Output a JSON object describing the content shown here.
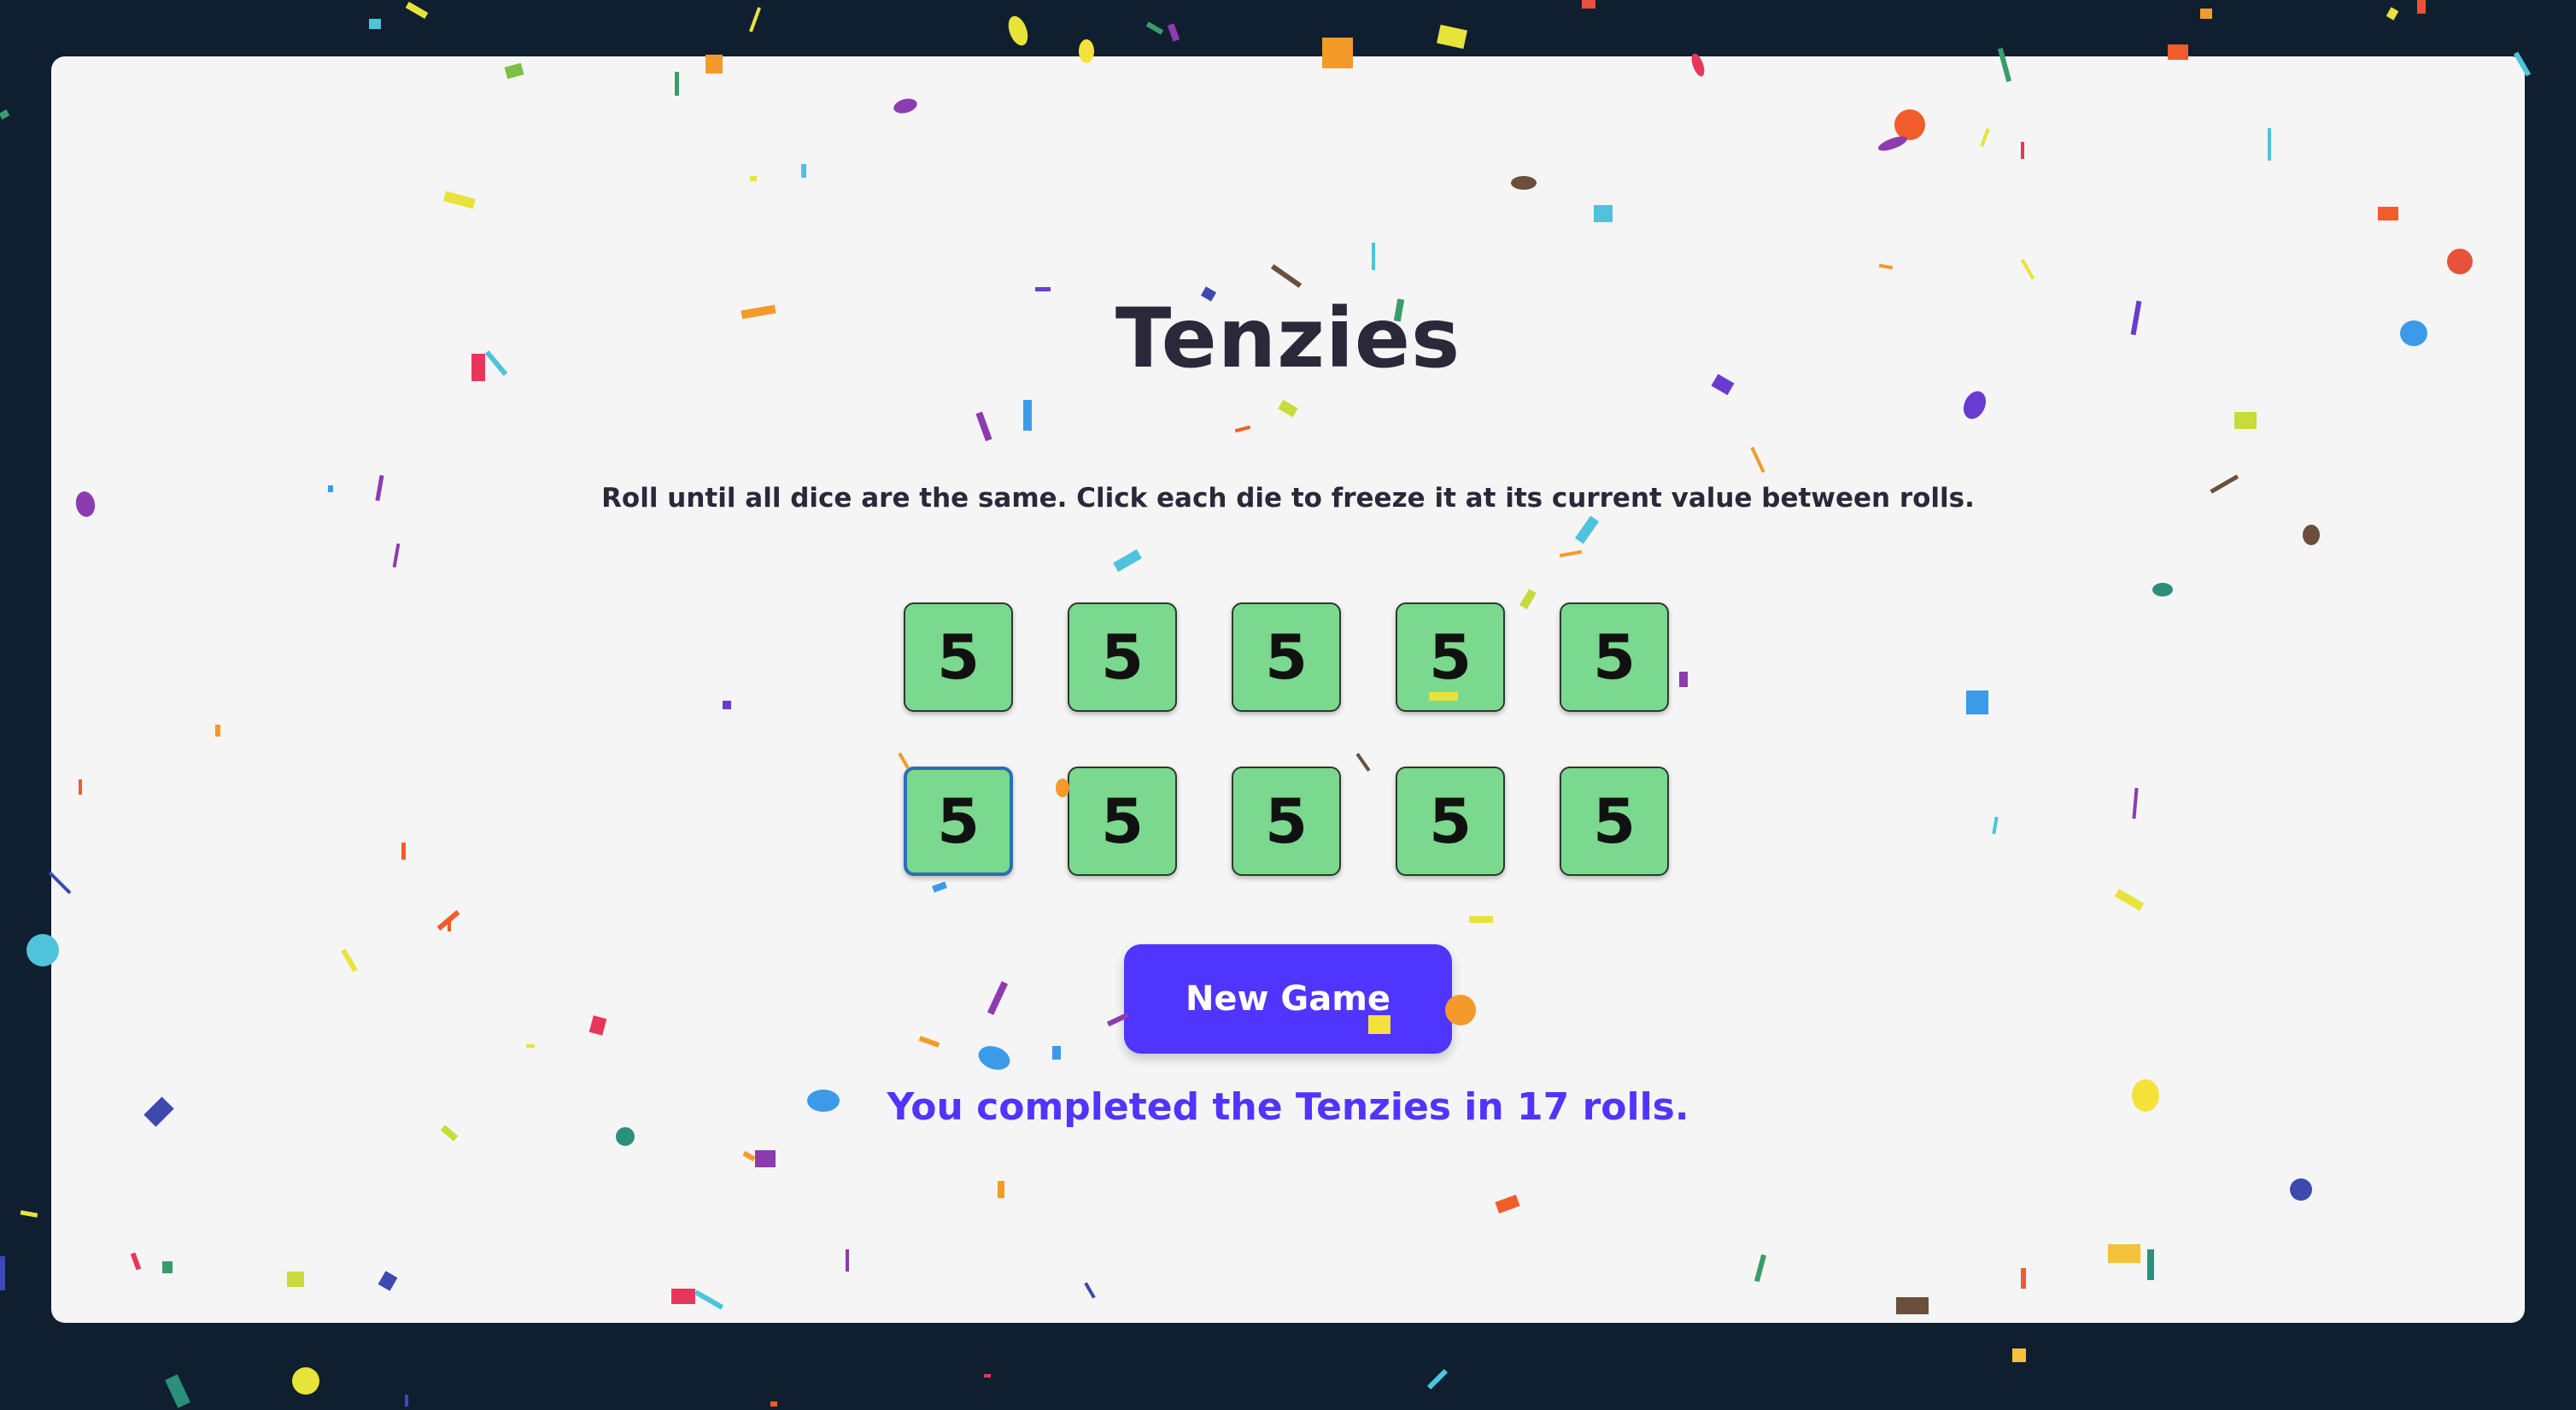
{
  "game": {
    "title": "Tenzies",
    "instructions": "Roll until all dice are the same. Click each die to freeze it at its current value between rolls.",
    "dice": [
      {
        "value": "5",
        "held": true
      },
      {
        "value": "5",
        "held": true
      },
      {
        "value": "5",
        "held": true
      },
      {
        "value": "5",
        "held": true
      },
      {
        "value": "5",
        "held": true
      },
      {
        "value": "5",
        "held": true
      },
      {
        "value": "5",
        "held": true
      },
      {
        "value": "5",
        "held": true
      },
      {
        "value": "5",
        "held": true
      },
      {
        "value": "5",
        "held": true
      }
    ],
    "new_game_label": "New Game",
    "result_message": "You completed the Tenzies in 17 rolls."
  },
  "colors": {
    "page_background": "#0f1f30",
    "board_background": "#f5f5f5",
    "held_die": "#7bd88f",
    "accent": "#5035ff",
    "title_text": "#2b283a"
  }
}
